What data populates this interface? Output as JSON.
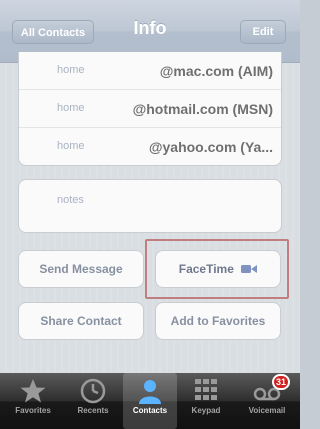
{
  "navbar": {
    "back_label": "All Contacts",
    "title": "Info",
    "edit_label": "Edit"
  },
  "emails": [
    {
      "label": "home",
      "value": "@mac.com (AIM)"
    },
    {
      "label": "home",
      "value": "@hotmail.com (MSN)"
    },
    {
      "label": "home",
      "value": "@yahoo.com (Ya..."
    }
  ],
  "notes_label": "notes",
  "actions": {
    "send_message": "Send Message",
    "facetime": "FaceTime",
    "share_contact": "Share Contact",
    "add_favorites": "Add to Favorites"
  },
  "tabs": [
    {
      "label": "Favorites",
      "icon": "star-icon"
    },
    {
      "label": "Recents",
      "icon": "clock-icon"
    },
    {
      "label": "Contacts",
      "icon": "person-icon",
      "selected": true
    },
    {
      "label": "Keypad",
      "icon": "keypad-icon"
    },
    {
      "label": "Voicemail",
      "icon": "voicemail-icon",
      "badge": "31"
    }
  ],
  "colors": {
    "highlight": "#a03a3a",
    "badge": "#d02020",
    "facetime_icon": "#3d5a9e"
  }
}
